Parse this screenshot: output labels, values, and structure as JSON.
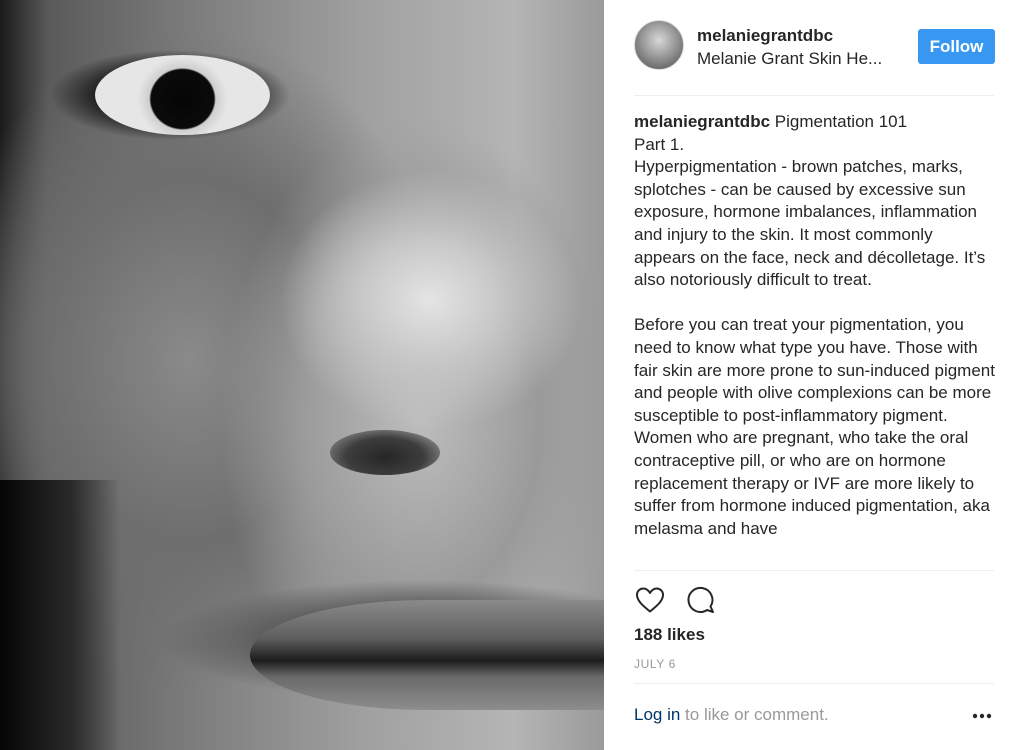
{
  "post": {
    "photo_alt": "Close-up black and white photo of a face with freckles",
    "header": {
      "username": "melaniegrantdbc",
      "subtitle": "Melanie Grant Skin He...",
      "follow_label": "Follow"
    },
    "caption": {
      "username": "melaniegrantdbc",
      "text": " Pigmentation 101\nPart 1.\nHyperpigmentation - brown patches, marks, splotches - can be caused by excessive sun exposure, hormone imbalances, inflammation and injury to the skin. It most commonly appears on the face, neck and décolletage. It’s also notoriously difficult to treat.\n\nBefore you can treat your pigmentation, you need to know what type you have. Those with fair skin are more prone to sun-induced pigment and people with olive complexions can be more susceptible to post-inflammatory pigment. Women who are pregnant, who take the oral contraceptive pill, or who are on hormone replacement therapy or IVF are more likely to suffer from hormone induced pigmentation, aka melasma and have"
    },
    "actions": {
      "like_icon": "heart-icon",
      "comment_icon": "comment-icon"
    },
    "likes": "188 likes",
    "date": "JULY 6",
    "comment_box": {
      "login_label": "Log in",
      "login_suffix": " to like or comment.",
      "more_icon": "more-options-icon"
    },
    "colors": {
      "follow_button": "#3897f0",
      "login_link": "#003569",
      "muted_text": "#999999",
      "divider": "#efefef"
    }
  }
}
